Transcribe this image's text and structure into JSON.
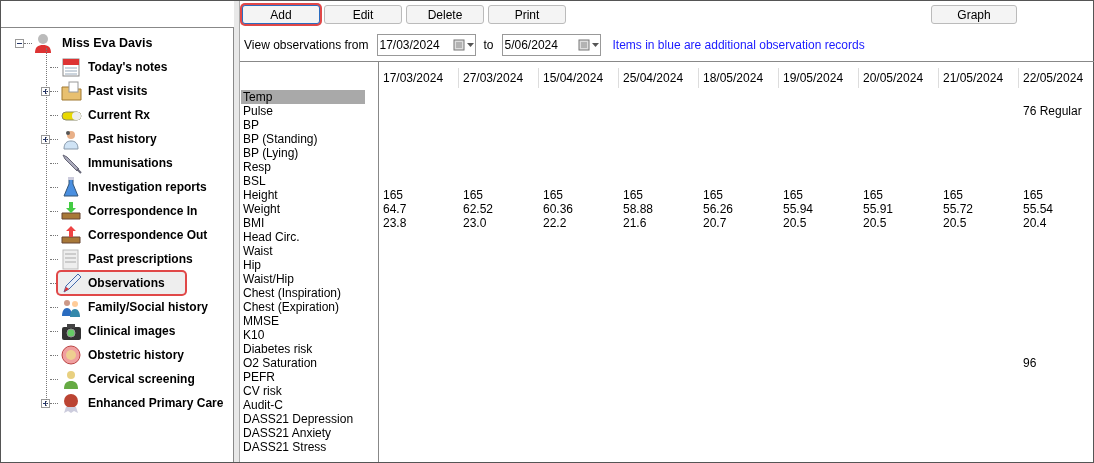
{
  "toolbar": {
    "buttons": [
      {
        "label": "Add",
        "highlighted": true
      },
      {
        "label": "Edit",
        "highlighted": false
      },
      {
        "label": "Delete",
        "highlighted": false
      },
      {
        "label": "Print",
        "highlighted": false
      }
    ],
    "graph_button": "Graph"
  },
  "tree": {
    "label": "Miss Eva Davis",
    "expanded": true,
    "children": [
      {
        "label": "Today's notes",
        "expandable": false,
        "highlighted": false
      },
      {
        "label": "Past visits",
        "expandable": true,
        "highlighted": false
      },
      {
        "label": "Current Rx",
        "expandable": false,
        "highlighted": false
      },
      {
        "label": "Past history",
        "expandable": true,
        "highlighted": false
      },
      {
        "label": "Immunisations",
        "expandable": false,
        "highlighted": false
      },
      {
        "label": "Investigation reports",
        "expandable": false,
        "highlighted": false
      },
      {
        "label": "Correspondence In",
        "expandable": false,
        "highlighted": false
      },
      {
        "label": "Correspondence Out",
        "expandable": false,
        "highlighted": false
      },
      {
        "label": "Past prescriptions",
        "expandable": false,
        "highlighted": false
      },
      {
        "label": "Observations",
        "expandable": false,
        "highlighted": true
      },
      {
        "label": "Family/Social history",
        "expandable": false,
        "highlighted": false
      },
      {
        "label": "Clinical images",
        "expandable": false,
        "highlighted": false
      },
      {
        "label": "Obstetric history",
        "expandable": false,
        "highlighted": false
      },
      {
        "label": "Cervical screening",
        "expandable": false,
        "highlighted": false
      },
      {
        "label": "Enhanced Primary Care",
        "expandable": true,
        "highlighted": false
      }
    ]
  },
  "filter": {
    "label": "View observations from",
    "from": "17/03/2024",
    "to_label": "to",
    "to": "5/06/2024",
    "note": "Items in blue are additional observation records"
  },
  "observations": {
    "columns": [
      "17/03/2024",
      "27/03/2024",
      "15/04/2024",
      "25/04/2024",
      "18/05/2024",
      "19/05/2024",
      "20/05/2024",
      "21/05/2024",
      "22/05/2024"
    ],
    "rows": [
      {
        "label": "Temp",
        "selected": true
      },
      {
        "label": "Pulse",
        "selected": false,
        "values": {
          "column_9": "76 Regular"
        }
      },
      {
        "label": "BP",
        "selected": false
      },
      {
        "label": "BP (Standing)",
        "selected": false
      },
      {
        "label": "BP (Lying)",
        "selected": false
      },
      {
        "label": "Resp",
        "selected": false
      },
      {
        "label": "BSL",
        "selected": false
      },
      {
        "label": "Height",
        "selected": false,
        "values": {
          "column_1": "165",
          "column_2": "165",
          "column_3": "165",
          "column_4": "165",
          "column_5": "165",
          "column_6": "165",
          "column_7": "165",
          "column_8": "165",
          "column_9": "165"
        }
      },
      {
        "label": "Weight",
        "selected": false,
        "values": {
          "column_1": "64.7",
          "column_2": "62.52",
          "column_3": "60.36",
          "column_4": "58.88",
          "column_5": "56.26",
          "column_6": "55.94",
          "column_7": "55.91",
          "column_8": "55.72",
          "column_9": "55.54"
        }
      },
      {
        "label": "BMI",
        "selected": false,
        "values": {
          "column_1": "23.8",
          "column_2": "23.0",
          "column_3": "22.2",
          "column_4": "21.6",
          "column_5": "20.7",
          "column_6": "20.5",
          "column_7": "20.5",
          "column_8": "20.5",
          "column_9": "20.4"
        }
      },
      {
        "label": "Head Circ.",
        "selected": false
      },
      {
        "label": "Waist",
        "selected": false
      },
      {
        "label": "Hip",
        "selected": false
      },
      {
        "label": "Waist/Hip",
        "selected": false
      },
      {
        "label": "Chest (Inspiration)",
        "selected": false
      },
      {
        "label": "Chest (Expiration)",
        "selected": false
      },
      {
        "label": "MMSE",
        "selected": false
      },
      {
        "label": "K10",
        "selected": false
      },
      {
        "label": "Diabetes risk",
        "selected": false
      },
      {
        "label": "O2 Saturation",
        "selected": false,
        "values": {
          "column_9": "96"
        }
      },
      {
        "label": "PEFR",
        "selected": false
      },
      {
        "label": "CV risk",
        "selected": false
      },
      {
        "label": "Audit-C",
        "selected": false
      },
      {
        "label": "DASS21 Depression",
        "selected": false
      },
      {
        "label": "DASS21 Anxiety",
        "selected": false
      },
      {
        "label": "DASS21 Stress",
        "selected": false
      }
    ]
  }
}
